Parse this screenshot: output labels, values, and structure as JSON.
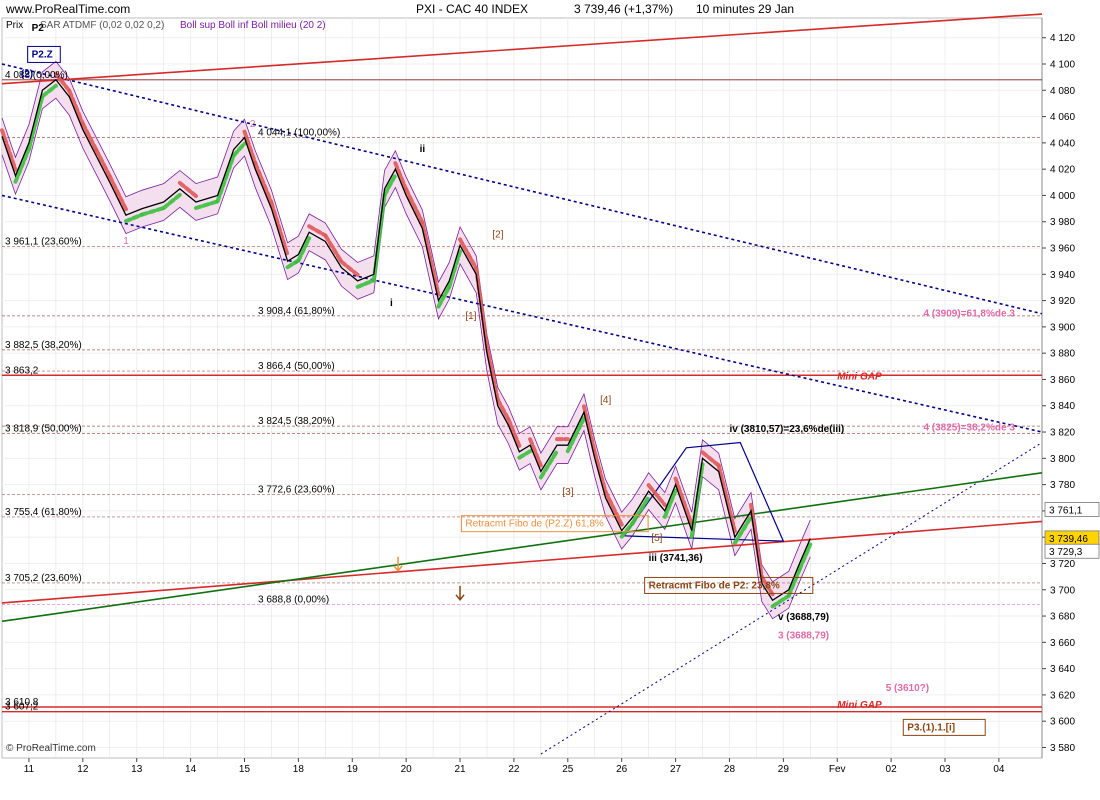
{
  "header": {
    "site": "www.ProRealTime.com",
    "instrument": "PXI - CAC 40 INDEX",
    "last": "3 739,46 (+1,37%)",
    "period": "10 minutes  29 Jan"
  },
  "subheader": {
    "prix": "Prix",
    "sar": "SAR ATDMF (0,02 0,02 0,2)",
    "boll": "Boll sup Boll inf Boll milieu (20 2)"
  },
  "footer": "© ProRealTime.com",
  "colors": {
    "background": "#ffffff",
    "price": "#000000",
    "channel": "#00008b",
    "red_line": "#d62a2a",
    "green_line": "#107010",
    "fib": "#8a2a2a",
    "pink": "#e06aa8",
    "boll_fill": "#f3dcec",
    "boll_line": "#7a1fa0",
    "sar_up": "#3dbf3d",
    "sar_down": "#e05a5a",
    "label_brown": "#8b4513",
    "orange": "#f0903c"
  },
  "chart_data": {
    "type": "line",
    "title": "PXI - CAC 40 INDEX",
    "xlabel": "",
    "ylabel": "Prix",
    "ylim": [
      3572,
      4135
    ],
    "y_ticks": [
      3580,
      3600,
      3620,
      3640,
      3660,
      3680,
      3700,
      3720,
      3740,
      3760,
      3780,
      3800,
      3820,
      3840,
      3860,
      3880,
      3900,
      3920,
      3940,
      3960,
      3980,
      4000,
      4020,
      4040,
      4060,
      4080,
      4100,
      4120
    ],
    "x_ticks": [
      "11",
      "12",
      "13",
      "14",
      "15",
      "18",
      "19",
      "20",
      "21",
      "22",
      "25",
      "26",
      "27",
      "28",
      "29",
      "Fev",
      "02",
      "03",
      "04"
    ],
    "x_tick_positions": [
      0.5,
      1.5,
      2.5,
      3.5,
      4.5,
      5.5,
      6.5,
      7.5,
      8.5,
      9.5,
      10.5,
      11.5,
      12.5,
      13.5,
      14.5,
      15.5,
      16.5,
      17.5,
      18.5
    ],
    "xlim": [
      0,
      19.3
    ],
    "price": {
      "x": [
        0,
        0.25,
        0.5,
        0.75,
        1.0,
        1.25,
        1.5,
        1.75,
        2.0,
        2.3,
        2.6,
        3.0,
        3.3,
        3.6,
        4.0,
        4.3,
        4.5,
        4.7,
        5.0,
        5.3,
        5.5,
        5.7,
        6.0,
        6.3,
        6.6,
        6.9,
        7.1,
        7.3,
        7.5,
        7.8,
        8.1,
        8.3,
        8.5,
        8.8,
        9.0,
        9.2,
        9.4,
        9.6,
        9.8,
        10.0,
        10.3,
        10.5,
        10.8,
        11.0,
        11.2,
        11.5,
        11.7,
        12.0,
        12.3,
        12.5,
        12.8,
        13.0,
        13.3,
        13.6,
        13.9,
        14.1,
        14.3,
        14.6,
        14.8,
        15.0
      ],
      "y": [
        4045,
        4015,
        4040,
        4080,
        4088,
        4075,
        4050,
        4030,
        4010,
        3985,
        3990,
        3995,
        4005,
        3995,
        4000,
        4035,
        4044,
        4020,
        3990,
        3950,
        3955,
        3972,
        3965,
        3945,
        3935,
        3940,
        4005,
        4020,
        4000,
        3975,
        3920,
        3935,
        3962,
        3940,
        3880,
        3840,
        3825,
        3805,
        3810,
        3790,
        3810,
        3810,
        3835,
        3800,
        3770,
        3745,
        3755,
        3775,
        3760,
        3780,
        3745,
        3800,
        3790,
        3740,
        3760,
        3705,
        3692,
        3700,
        3720,
        3739
      ]
    },
    "y_labels_left": [
      {
        "text": "3 961,1 (23,60%)",
        "y": 3961.1
      },
      {
        "text": "3 882,5 (38,20%)",
        "y": 3882.5
      },
      {
        "text": "3 863,2",
        "y": 3863.2
      },
      {
        "text": "3 818,9 (50,00%)",
        "y": 3818.9
      },
      {
        "text": "3 755,4 (61,80%)",
        "y": 3755.4
      },
      {
        "text": "3 705,2 (23,60%)",
        "y": 3705.2
      },
      {
        "text": "3 610,8",
        "y": 3610.8
      },
      {
        "text": "3 607,2",
        "y": 3607.2
      }
    ],
    "y_labels_mid": [
      {
        "text": "3 908,4 (61,80%)",
        "y": 3908.4
      },
      {
        "text": "3 866,4 (50,00%)",
        "y": 3866.4
      },
      {
        "text": "3 824,5 (38,20%)",
        "y": 3824.5
      },
      {
        "text": "3 772,6 (23,60%)",
        "y": 3772.6
      },
      {
        "text": "3 688,8 (0,00%)",
        "y": 3688.8
      },
      {
        "text": "4 044,1 (100,00%)",
        "y": 4044.1
      },
      {
        "text": "4 088 (0,00%)",
        "y": 4088
      }
    ],
    "price_boxes": [
      {
        "text": "3 761,1",
        "y": 3761.1
      },
      {
        "text": "3 739,46",
        "y": 3739.46
      },
      {
        "text": "3 729,3",
        "y": 3729.3
      }
    ],
    "wave_labels": [
      {
        "text": "P2",
        "x": 0.55,
        "y": 4125
      },
      {
        "text": "P2.Z",
        "x": 0.55,
        "y": 4105
      },
      {
        "text": "(2)",
        "x": 0.35,
        "y": 4090
      },
      {
        "text": "1",
        "x": 2.25,
        "y": 3963
      },
      {
        "text": "2",
        "x": 4.6,
        "y": 4052
      },
      {
        "text": "ii",
        "x": 7.75,
        "y": 4033
      },
      {
        "text": "i",
        "x": 7.2,
        "y": 3916
      },
      {
        "text": "[2]",
        "x": 9.1,
        "y": 3968
      },
      {
        "text": "[1]",
        "x": 8.6,
        "y": 3906
      },
      {
        "text": "[4]",
        "x": 11.1,
        "y": 3842
      },
      {
        "text": "[3]",
        "x": 10.4,
        "y": 3772
      },
      {
        "text": "[5]",
        "x": 12.05,
        "y": 3737
      },
      {
        "text": "iii (3741,36)",
        "x": 12.0,
        "y": 3722
      },
      {
        "text": "iv (3810,57)=23,6%de(iii)",
        "x": 13.5,
        "y": 3820
      },
      {
        "text": "v (3688,79)",
        "x": 14.4,
        "y": 3677
      },
      {
        "text": "3 (3688,79)",
        "x": 14.4,
        "y": 3663
      },
      {
        "text": "4 (3909)=61,8%de 3",
        "x": 17.1,
        "y": 3908
      },
      {
        "text": "4 (3825)=38,2%de 3",
        "x": 17.1,
        "y": 3821
      },
      {
        "text": "Mini GAP",
        "x": 15.5,
        "y": 3860
      },
      {
        "text": "Mini GAP",
        "x": 15.5,
        "y": 3610
      },
      {
        "text": "5 (3610?)",
        "x": 16.4,
        "y": 3623
      },
      {
        "text": "P3.(1).1.[i]",
        "x": 16.8,
        "y": 3593
      },
      {
        "text": "Retracmt Fibo de (P2.Z) 61,8%",
        "x": 8.6,
        "y": 3748
      },
      {
        "text": "Retracmt Fibo de P2: 23,8%",
        "x": 12.0,
        "y": 3701
      }
    ]
  }
}
